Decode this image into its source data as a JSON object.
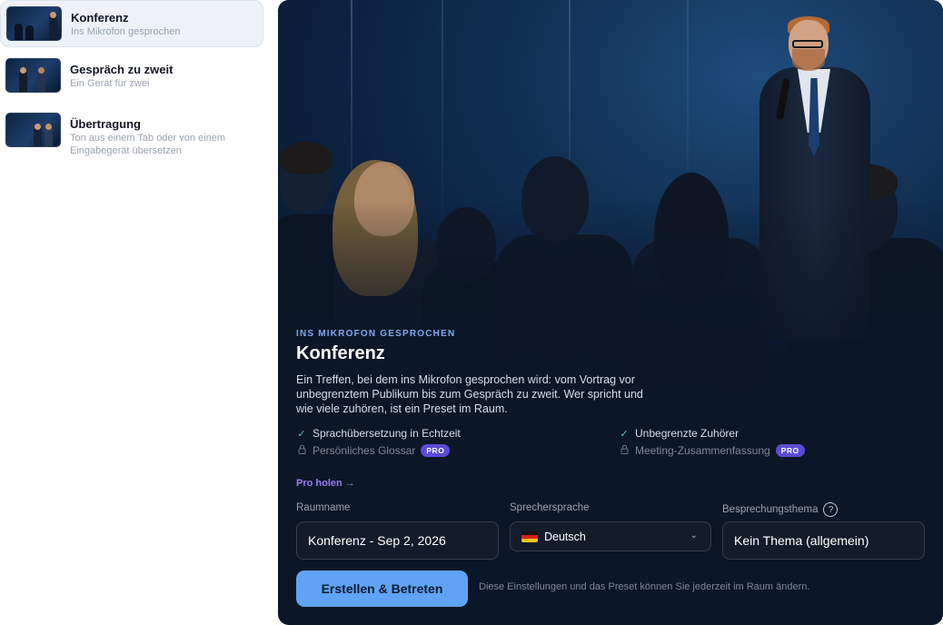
{
  "sidebar": {
    "presets": [
      {
        "title": "Konferenz",
        "subtitle": "Ins Mikrofon gesprochen",
        "active": true
      },
      {
        "title": "Gespräch zu zweit",
        "subtitle": "Ein Gerät für zwei",
        "active": false
      },
      {
        "title": "Übertragung",
        "subtitle": "Ton aus einem Tab oder von einem Eingabegerät übersetzen",
        "active": false
      }
    ]
  },
  "hero": {
    "eyebrow": "INS MIKROFON GESPROCHEN",
    "title": "Konferenz",
    "description": "Ein Treffen, bei dem ins Mikrofon gesprochen wird: vom Vortrag vor unbegrenztem Publikum bis zum Gespräch zu zweit. Wer spricht und wie viele zuhören, ist ein Preset im Raum."
  },
  "features": {
    "realtime_translation": "Sprachübersetzung in Echtzeit",
    "unlimited_listeners": "Unbegrenzte Zuhörer",
    "personal_glossary": "Persönliches Glossar",
    "meeting_summary": "Meeting-Zusammenfassung",
    "pro_badge": "PRO",
    "check_icon": "check-icon",
    "lock_icon": "lock-icon"
  },
  "pro_link": "Pro holen →",
  "form": {
    "room_name_label": "Raumname",
    "room_name_value": "Konferenz - Sep 2, 2026",
    "speaker_language_label": "Sprechersprache",
    "speaker_language_value": "Deutsch",
    "topic_label": "Besprechungsthema",
    "topic_value": "Kein Thema (allgemein)"
  },
  "actions": {
    "create_label": "Erstellen & Betreten",
    "hint": "Diese Einstellungen und das Preset können Sie jederzeit im Raum ändern."
  },
  "colors": {
    "accent": "#5fa3f7",
    "eyebrow": "#7ea9ee",
    "pro": "#5b4bd6",
    "pro_link": "#9a7cf5",
    "check": "#5fc7b0"
  }
}
